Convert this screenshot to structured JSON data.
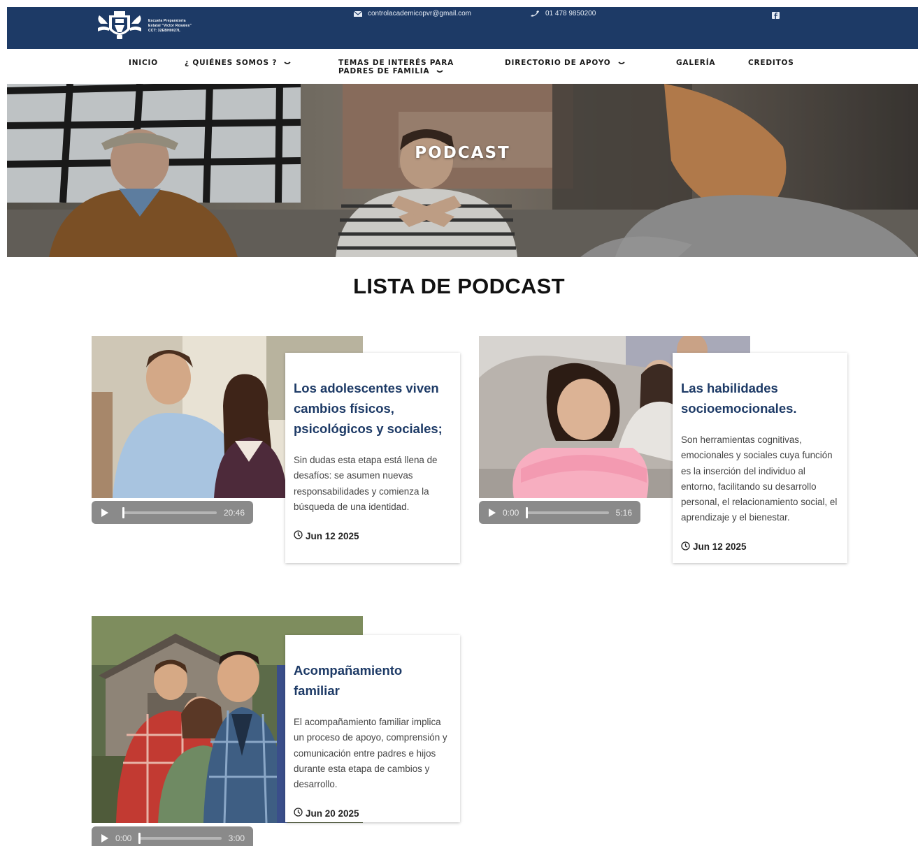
{
  "header": {
    "school_lines": [
      "Escuela Preparatoria",
      "Estatal \"Víctor Rosales\"",
      "CCT: 32EBH0027L"
    ],
    "email": "controlacademicopvr@gmail.com",
    "phone": "01 478 9850200",
    "brand_color": "#1d3a66"
  },
  "nav": {
    "items": [
      {
        "label": "INICIO",
        "has_dropdown": false
      },
      {
        "label": "¿ QUIÉNES SOMOS ?",
        "has_dropdown": true
      },
      {
        "label": "TEMAS DE INTERÉS PARA",
        "label2": "PADRES DE FAMILIA",
        "has_dropdown": true
      },
      {
        "label": "DIRECTORIO DE APOYO",
        "has_dropdown": true
      },
      {
        "label": "GALERÍA",
        "has_dropdown": false
      },
      {
        "label": "CREDITOS",
        "has_dropdown": false
      }
    ]
  },
  "hero": {
    "title": "PODCAST"
  },
  "section": {
    "title": "LISTA DE PODCAST"
  },
  "podcasts": [
    {
      "title": "Los adolescentes viven cambios físicos, psicológicos y sociales;",
      "description": "Sin dudas esta etapa está llena de desafíos: se asumen nuevas responsabilidades y comienza la búsqueda de una identidad.",
      "date": "Jun 12 2025",
      "time_display": "20:46",
      "current_time": ""
    },
    {
      "title": "Las habilidades socioemocionales.",
      "description": "Son herramientas cognitivas, emocionales y sociales cuya función es la inserción del individuo al entorno, facilitando su desarrollo personal, el relacionamiento social, el aprendizaje y el bienestar.",
      "date": "Jun 12 2025",
      "time_display": "5:16",
      "current_time": "0:00"
    },
    {
      "title": "Acompañamiento familiar",
      "description": "El acompañamiento familiar implica un proceso de apoyo, comprensión y comunicación entre padres e hijos durante esta etapa de cambios y desarrollo.",
      "date": "Jun 20 2025",
      "time_display": "3:00",
      "current_time": "0:00"
    }
  ]
}
